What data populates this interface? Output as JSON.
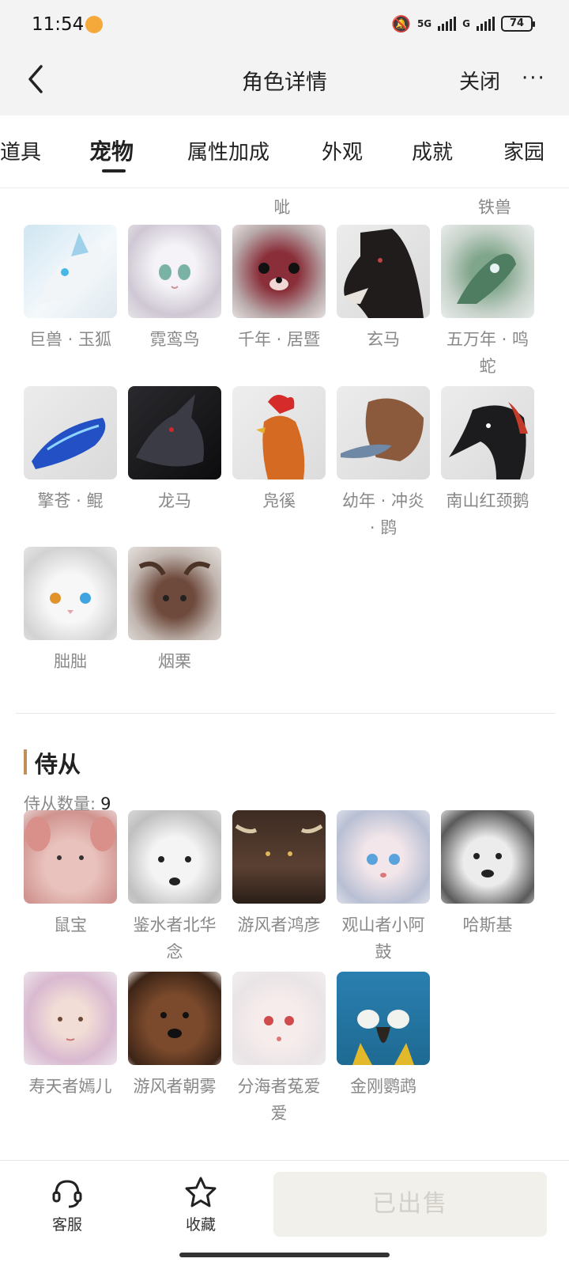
{
  "status_bar": {
    "time": "11:54",
    "network": "5G",
    "network2": "G",
    "battery": "74"
  },
  "nav": {
    "title": "角色详情",
    "close_label": "关闭",
    "more_label": "···",
    "back_icon": "chevron-left-icon"
  },
  "tabs": [
    {
      "label": "道具"
    },
    {
      "label": "宠物",
      "active": true
    },
    {
      "label": "属性加成"
    },
    {
      "label": "外观"
    },
    {
      "label": "成就"
    },
    {
      "label": "家园"
    }
  ],
  "pets": {
    "cut_labels": [
      "呲",
      "铁兽"
    ],
    "rows": [
      [
        "巨兽 · 玉狐",
        "霓鸾鸟",
        "千年 · 居暨",
        "玄马",
        "五万年 · 鸣蛇"
      ],
      [
        "擎苍 · 鲲",
        "龙马",
        "凫徯",
        "幼年 · 冲炎 · 鹍",
        "南山红颈鹅"
      ],
      [
        "朏朏",
        "烟栗"
      ]
    ]
  },
  "followers": {
    "title": "侍从",
    "count_label": "侍从数量:",
    "count": "9",
    "rows": [
      [
        "鼠宝",
        "鉴水者北华念",
        "游风者鸿彦",
        "观山者小阿鼓",
        "哈斯基"
      ],
      [
        "寿天者嫣儿",
        "游风者朝雾",
        "分海者菟爱爱",
        "金刚鹦鹉"
      ]
    ]
  },
  "bottom_bar": {
    "service_label": "客服",
    "favorite_label": "收藏",
    "sold_label": "已出售",
    "colors": {
      "accent": "#c28f5c",
      "sold_bg": "#f2f0eb",
      "sold_text": "#d3d0c9"
    }
  }
}
